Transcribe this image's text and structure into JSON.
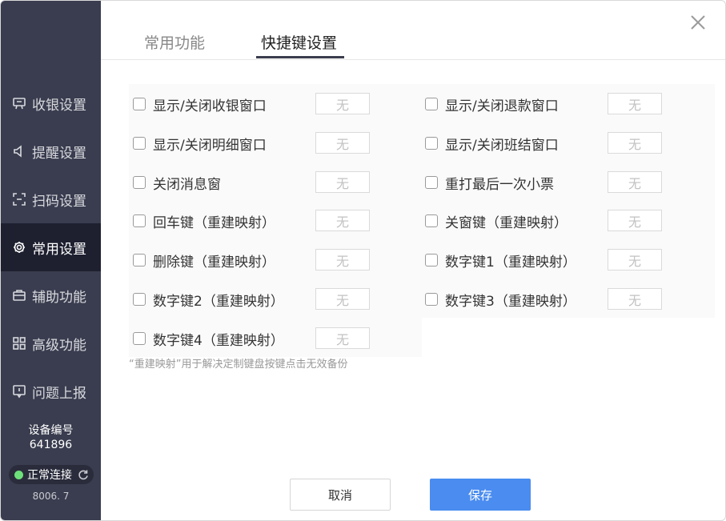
{
  "sidebar": {
    "items": [
      {
        "label": "收银设置",
        "icon": "cashier-icon"
      },
      {
        "label": "提醒设置",
        "icon": "speaker-icon"
      },
      {
        "label": "扫码设置",
        "icon": "scan-icon"
      },
      {
        "label": "常用设置",
        "icon": "gear-icon",
        "active": true
      },
      {
        "label": "辅助功能",
        "icon": "toolbox-icon"
      },
      {
        "label": "高级功能",
        "icon": "grid-icon"
      },
      {
        "label": "问题上报",
        "icon": "report-icon"
      }
    ],
    "device_label": "设备编号",
    "device_id": "641896",
    "connection_status": "正常连接",
    "version": "8006. 7"
  },
  "tabs": [
    {
      "label": "常用功能",
      "active": false
    },
    {
      "label": "快捷键设置",
      "active": true
    }
  ],
  "shortcuts": {
    "left": [
      {
        "label": "显示/关闭收银窗口",
        "key": "无"
      },
      {
        "label": "显示/关闭明细窗口",
        "key": "无"
      },
      {
        "label": "关闭消息窗",
        "key": "无"
      },
      {
        "label": "回车键（重建映射）",
        "key": "无"
      },
      {
        "label": "删除键（重建映射）",
        "key": "无"
      },
      {
        "label": "数字键2（重建映射）",
        "key": "无"
      },
      {
        "label": "数字键4（重建映射）",
        "key": "无"
      }
    ],
    "right": [
      {
        "label": "显示/关闭退款窗口",
        "key": "无"
      },
      {
        "label": "显示/关闭班结窗口",
        "key": "无"
      },
      {
        "label": "重打最后一次小票",
        "key": "无"
      },
      {
        "label": "关窗键（重建映射）",
        "key": "无"
      },
      {
        "label": "数字键1（重建映射）",
        "key": "无"
      },
      {
        "label": "数字键3（重建映射）",
        "key": "无"
      }
    ]
  },
  "note": "“重建映射”用于解决定制键盘按键点击无效备份",
  "footer": {
    "cancel_label": "取消",
    "save_label": "保存"
  },
  "colors": {
    "sidebar_bg": "#3a3d4f",
    "sidebar_active_bg": "#1e2030",
    "accent": "#4a8cf0",
    "status_green": "#6ee07a"
  }
}
